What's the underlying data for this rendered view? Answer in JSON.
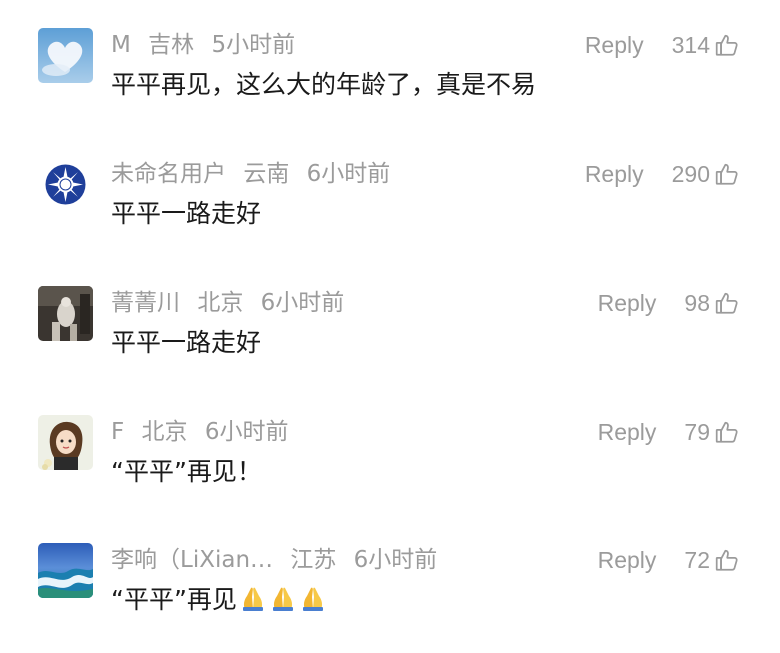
{
  "comments": [
    {
      "name": "M",
      "location": "吉林",
      "time": "5小时前",
      "reply_label": "Reply",
      "likes": "314",
      "text": "平平再见，这么大的年龄了，真是不易",
      "avatar_icon": "heart-cloud-avatar",
      "emojis": []
    },
    {
      "name": "未命名用户",
      "location": "云南",
      "time": "6小时前",
      "reply_label": "Reply",
      "likes": "290",
      "text": "平平一路走好",
      "avatar_icon": "blue-sun-emblem-avatar",
      "emojis": []
    },
    {
      "name": "菁菁川",
      "location": "北京",
      "time": "6小时前",
      "reply_label": "Reply",
      "likes": "98",
      "text": "平平一路走好",
      "avatar_icon": "dark-photo-avatar",
      "emojis": []
    },
    {
      "name": "F",
      "location": "北京",
      "time": "6小时前",
      "reply_label": "Reply",
      "likes": "79",
      "text": "“平平”再见！",
      "avatar_icon": "cartoon-girl-avatar",
      "emojis": []
    },
    {
      "name": "李响（LiXian…",
      "location": "江苏",
      "time": "6小时前",
      "reply_label": "Reply",
      "likes": "72",
      "text": "“平平”再见",
      "avatar_icon": "coastline-avatar",
      "emojis": [
        "folded-hands-icon",
        "folded-hands-icon",
        "folded-hands-icon"
      ]
    }
  ]
}
